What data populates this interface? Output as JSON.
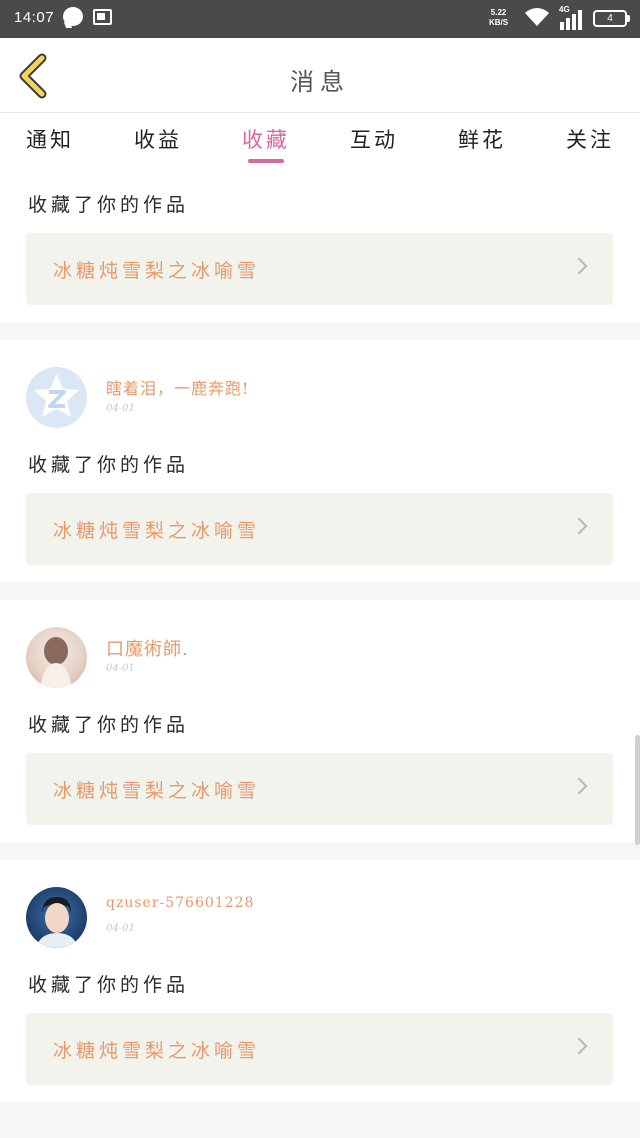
{
  "status_bar": {
    "time": "14:07",
    "speed_value": "5.22",
    "speed_unit": "KB/S",
    "network": "4G",
    "battery": "4"
  },
  "header": {
    "title": "消息",
    "back_icon": "chevron-left-icon"
  },
  "tabs": [
    {
      "label": "通知",
      "active": false
    },
    {
      "label": "收益",
      "active": false
    },
    {
      "label": "收藏",
      "active": true
    },
    {
      "label": "互动",
      "active": false
    },
    {
      "label": "鲜花",
      "active": false
    },
    {
      "label": "关注",
      "active": false
    }
  ],
  "colors": {
    "accent": "#d46aa0",
    "link": "#e69a6b",
    "box_bg": "#f3f3ed"
  },
  "messages": [
    {
      "action": "收藏了你的作品",
      "work_title": "冰糖炖雪梨之冰喻雪"
    },
    {
      "username": "瞎着泪，一鹿奔跑!",
      "date": "04-01",
      "avatar": "qzone-star-icon",
      "action": "收藏了你的作品",
      "work_title": "冰糖炖雪梨之冰喻雪"
    },
    {
      "username": "口魔術師.",
      "date": "04-01",
      "avatar": "girl-photo-avatar",
      "action": "收藏了你的作品",
      "work_title": "冰糖炖雪梨之冰喻雪"
    },
    {
      "username": "qzuser-576601228",
      "date": "04-01",
      "avatar": "boy-photo-avatar",
      "action": "收藏了你的作品",
      "work_title": "冰糖炖雪梨之冰喻雪"
    }
  ]
}
